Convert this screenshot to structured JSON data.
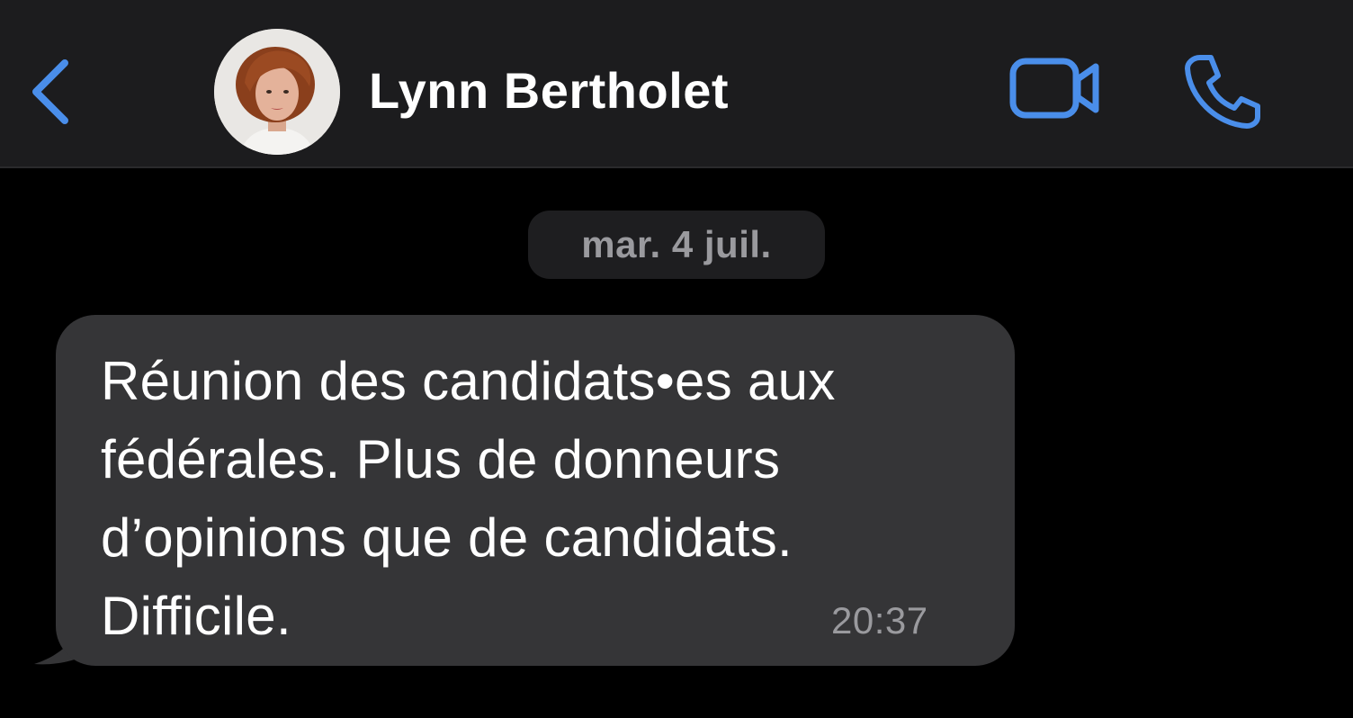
{
  "header": {
    "contact_name": "Lynn Bertholet",
    "accent_color": "#4a8eea",
    "icons": {
      "back": "chevron-left-icon",
      "video": "video-camera-icon",
      "call": "phone-icon"
    }
  },
  "conversation": {
    "date_separator": "mar. 4 juil.",
    "messages": [
      {
        "direction": "incoming",
        "lines": [
          "Réunion des candidats•es aux",
          "fédérales. Plus de donneurs",
          "d’opinions que de candidats.",
          "Difficile."
        ],
        "time": "20:37"
      }
    ]
  }
}
